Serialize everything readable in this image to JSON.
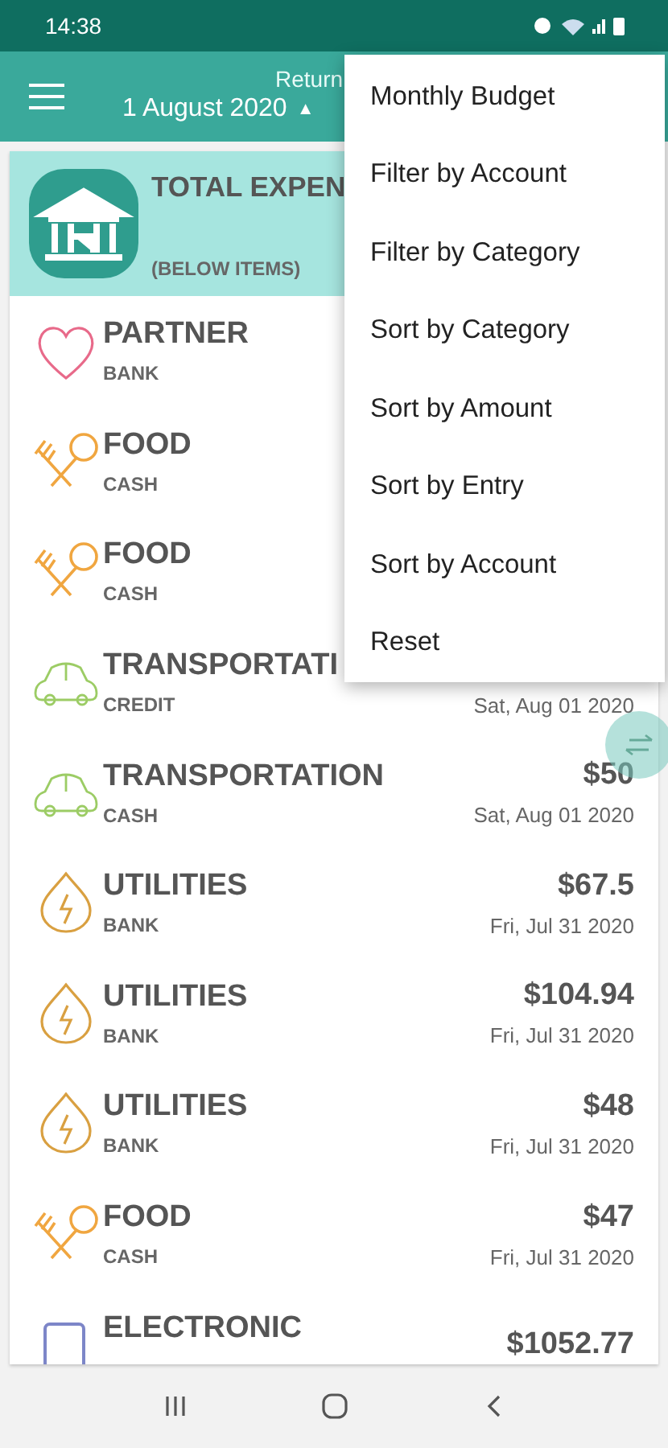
{
  "status_bar": {
    "time": "14:38"
  },
  "toolbar": {
    "title": "Return",
    "date": "1 August 2020",
    "date_caret": "▲"
  },
  "summary": {
    "title": "TOTAL EXPEN",
    "subtitle": "(BELOW ITEMS)"
  },
  "entries": [
    {
      "kind": "heart",
      "category": "PARTNER",
      "account": "BANK"
    },
    {
      "kind": "food",
      "category": "FOOD",
      "account": "CASH"
    },
    {
      "kind": "food",
      "category": "FOOD",
      "account": "CASH"
    },
    {
      "kind": "car",
      "category": "TRANSPORTATI",
      "account": "CREDIT",
      "date": "Sat, Aug 01 2020"
    },
    {
      "kind": "car",
      "category": "TRANSPORTATION",
      "account": "CASH",
      "amount": "$50",
      "date": "Sat, Aug 01 2020"
    },
    {
      "kind": "utility",
      "category": "UTILITIES",
      "account": "BANK",
      "amount": "$67.5",
      "date": "Fri, Jul 31 2020"
    },
    {
      "kind": "utility",
      "category": "UTILITIES",
      "account": "BANK",
      "amount": "$104.94",
      "date": "Fri, Jul 31 2020"
    },
    {
      "kind": "utility",
      "category": "UTILITIES",
      "account": "BANK",
      "amount": "$48",
      "date": "Fri, Jul 31 2020"
    },
    {
      "kind": "food",
      "category": "FOOD",
      "account": "CASH",
      "amount": "$47",
      "date": "Fri, Jul 31 2020"
    },
    {
      "kind": "device",
      "category": "ELECTRONIC",
      "amount": "$1052.77"
    }
  ],
  "menu": [
    "Monthly Budget",
    "Filter by Account",
    "Filter by Category",
    "Sort by Category",
    "Sort by Amount",
    "Sort by Entry",
    "Sort by Account",
    "Reset"
  ]
}
